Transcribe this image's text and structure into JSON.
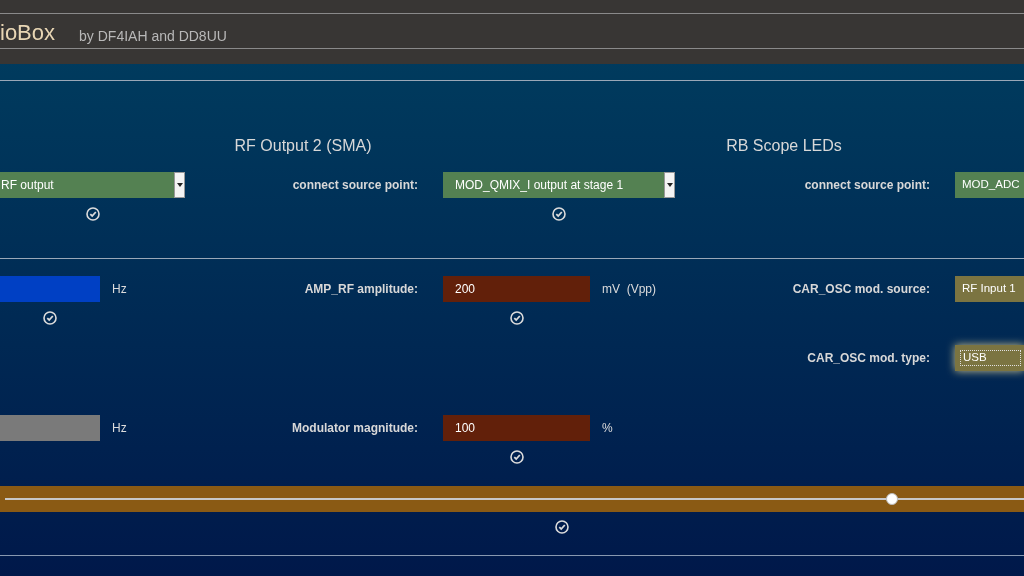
{
  "header": {
    "title": "ioBox",
    "subtitle": "by DF4IAH and DD8UU"
  },
  "sections": [
    {
      "heading": "RF Output 2 (SMA)"
    },
    {
      "heading": "RB Scope LEDs"
    }
  ],
  "rows": [
    {
      "c1": {
        "kind": "dropdown",
        "value": "RF output",
        "color": "#548152",
        "confirm_icon": true
      },
      "l2": "connect source point:",
      "c2": {
        "kind": "dropdown",
        "value": "MOD_QMIX_I output at stage 1",
        "color": "#548152",
        "confirm_icon": true
      },
      "l3": "connect source point:",
      "c3": {
        "kind": "choice",
        "value": "MOD_ADC",
        "color": "#548152"
      }
    },
    {
      "c1": {
        "kind": "input",
        "color": "#0040c4",
        "unit": "Hz",
        "confirm_icon": true
      },
      "l2": "AMP_RF amplitude:",
      "c2": {
        "kind": "input",
        "value": "200",
        "color": "#62200a",
        "unit": "mV  (Vpp)",
        "confirm_icon": true
      },
      "l3": "CAR_OSC mod. source:",
      "c3": {
        "kind": "choice",
        "value": "RF Input 1",
        "color": "#7b7441"
      }
    },
    {
      "l3": "CAR_OSC mod. type:",
      "c3": {
        "kind": "choice",
        "value": "USB",
        "color": "#7b7441",
        "focused": true
      }
    },
    {
      "c1": {
        "kind": "input",
        "color": "#7a7a7a",
        "unit": "Hz"
      },
      "l2": "Modulator magnitude:",
      "c2": {
        "kind": "input",
        "value": "100",
        "color": "#62200a",
        "unit": "%",
        "confirm_icon": true
      }
    }
  ],
  "slider": {
    "level": 0.87,
    "color": "#8a5a14",
    "confirm_icon": true
  }
}
